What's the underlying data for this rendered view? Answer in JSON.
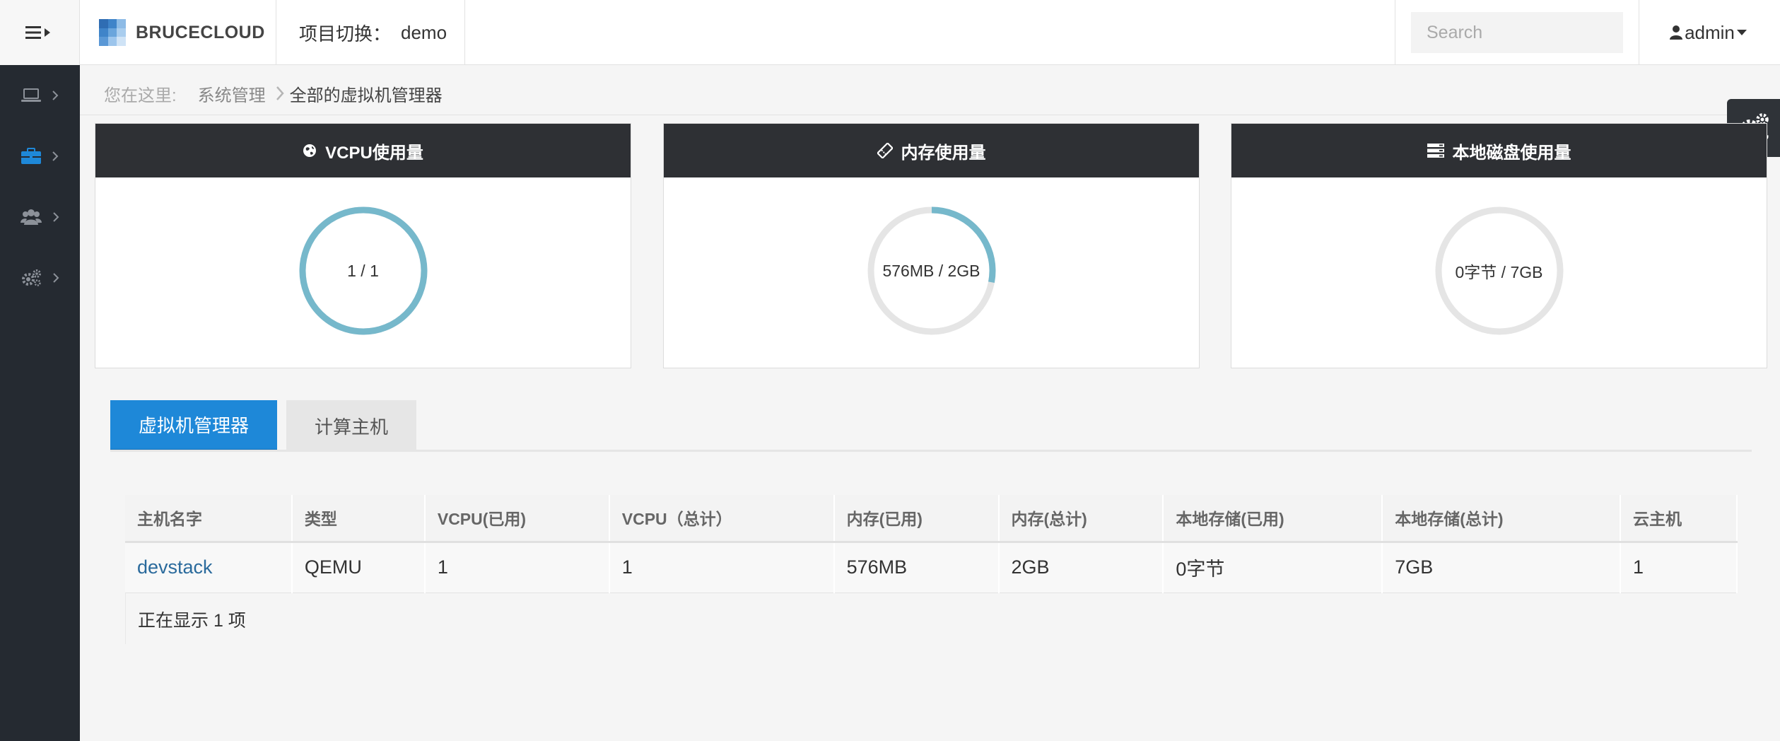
{
  "header": {
    "brand_name": "BRUCECLOUD",
    "project_switch_label": "项目切换：",
    "project_name": "demo",
    "search_placeholder": "Search",
    "username": "admin"
  },
  "sidebar": {
    "items": [
      {
        "icon": "laptop-icon"
      },
      {
        "icon": "briefcase-icon",
        "active": true
      },
      {
        "icon": "users-icon"
      },
      {
        "icon": "gears-icon"
      }
    ]
  },
  "breadcrumb": {
    "prefix": "您在这里:",
    "section": "系统管理",
    "current": "全部的虚拟机管理器"
  },
  "cards": [
    {
      "title": "VCPU使用量",
      "icon": "globe-icon",
      "display": "1 / 1",
      "used_fraction": 1.0
    },
    {
      "title": "内存使用量",
      "icon": "ticket-icon",
      "display": "576MB / 2GB",
      "used_fraction": 0.28
    },
    {
      "title": "本地磁盘使用量",
      "icon": "server-icon",
      "display": "0字节 / 7GB",
      "used_fraction": 0.0
    }
  ],
  "tabs": [
    {
      "label": "虚拟机管理器",
      "active": true
    },
    {
      "label": "计算主机",
      "active": false
    }
  ],
  "table": {
    "columns": [
      "主机名字",
      "类型",
      "VCPU(已用)",
      "VCPU（总计）",
      "内存(已用)",
      "内存(总计)",
      "本地存储(已用)",
      "本地存储(总计)",
      "云主机"
    ],
    "rows": [
      [
        "devstack",
        "QEMU",
        "1",
        "1",
        "576MB",
        "2GB",
        "0字节",
        "7GB",
        "1"
      ]
    ],
    "footer": "正在显示 1 项"
  },
  "colors": {
    "accent": "#1e88d8",
    "gauge_used": "#76b8cb",
    "gauge_track": "#e5e5e5",
    "sidebar_bg": "#252a31",
    "card_header_bg": "#2e3034"
  }
}
